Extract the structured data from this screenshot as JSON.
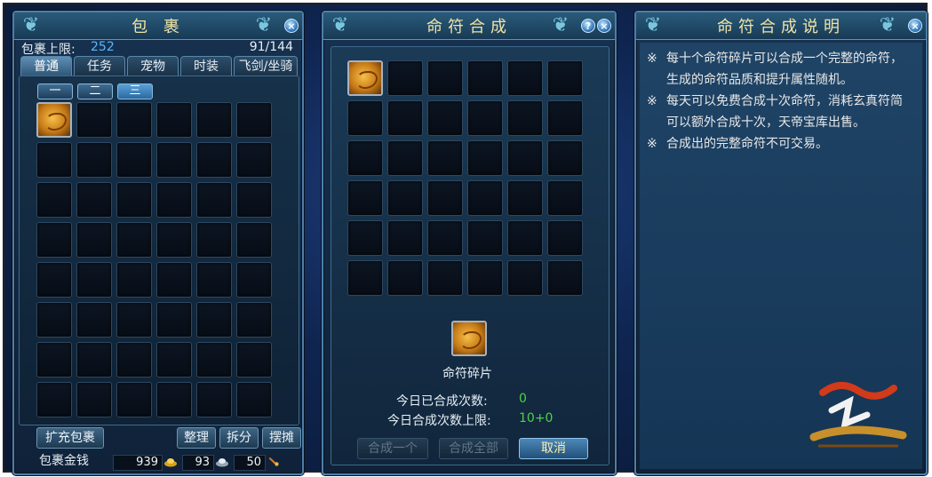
{
  "bag": {
    "title": "包 裹",
    "capacity_label": "包裹上限:",
    "capacity_value": "252",
    "usage": "91/144",
    "tabs": [
      "普通",
      "任务",
      "宠物",
      "时装",
      "飞剑/坐骑"
    ],
    "subtabs": [
      "一",
      "二",
      "三"
    ],
    "buttons": {
      "expand": "扩充包裹",
      "sort": "整理",
      "split": "拆分",
      "stall": "摆摊"
    },
    "money_label": "包裹金钱",
    "money": {
      "gold": "939",
      "silver": "93",
      "coupon": "50"
    },
    "grid": {
      "rows": 8,
      "cols": 6
    }
  },
  "compose": {
    "title": "命符合成",
    "item_name": "命符碎片",
    "today_count_label": "今日已合成次数:",
    "today_count_value": "0",
    "today_limit_label": "今日合成次数上限:",
    "today_limit_value": "10+0",
    "buttons": {
      "one": "合成一个",
      "all": "合成全部",
      "cancel": "取消"
    },
    "grid": {
      "rows": 6,
      "cols": 6
    }
  },
  "help": {
    "title": "命符合成说明",
    "lines": [
      "每十个命符碎片可以合成一个完整的命符，生成的命符品质和提升属性随机。",
      "每天可以免费合成十次命符，消耗玄真符简可以额外合成十次，天帝宝库出售。",
      "合成出的完整命符不可交易。"
    ],
    "bullet": "※"
  },
  "colors": {
    "accent_green": "#4fd14a",
    "capacity_blue": "#57b9ff",
    "title_gold": "#f1e3a6"
  },
  "icons": {
    "close": "×",
    "help": "?"
  }
}
